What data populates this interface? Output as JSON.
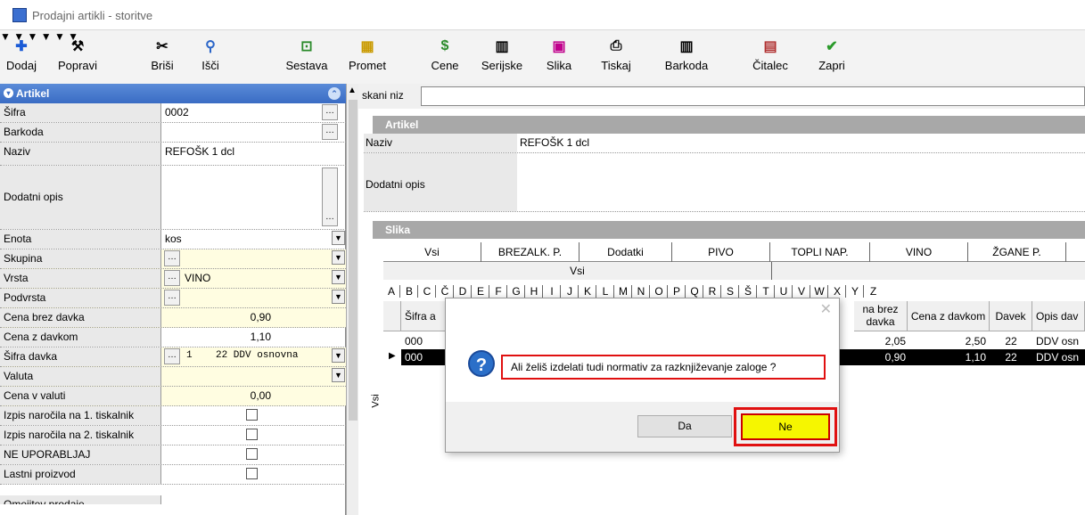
{
  "window": {
    "title": "Prodajni artikli - storitve"
  },
  "toolbar": {
    "items": [
      {
        "label": "Dodaj",
        "icon": "plus-icon"
      },
      {
        "label": "Popravi",
        "icon": "hammer-icon"
      },
      {
        "label": "Briši",
        "icon": "scissors-icon"
      },
      {
        "label": "Išči",
        "icon": "magnifier-icon"
      },
      {
        "label": "Sestava",
        "icon": "composition-icon"
      },
      {
        "label": "Promet",
        "icon": "turnover-icon"
      },
      {
        "label": "Cene",
        "icon": "price-icon"
      },
      {
        "label": "Serijske",
        "icon": "barcode-icon"
      },
      {
        "label": "Slika",
        "icon": "image-icon"
      },
      {
        "label": "Tiskaj",
        "icon": "printer-icon"
      },
      {
        "label": "Barkoda",
        "icon": "barcode-icon"
      },
      {
        "label": "Čitalec",
        "icon": "reader-icon"
      },
      {
        "label": "Zapri",
        "icon": "checkmark-icon"
      }
    ]
  },
  "left_panel": {
    "header": "Artikel",
    "fields": {
      "sifra": {
        "label": "Šifra",
        "value": "0002"
      },
      "barkoda": {
        "label": "Barkoda",
        "value": ""
      },
      "naziv": {
        "label": "Naziv",
        "value": "REFOŠK 1 dcl"
      },
      "dodatni_opis": {
        "label": "Dodatni opis",
        "value": ""
      },
      "enota": {
        "label": "Enota",
        "value": "kos"
      },
      "skupina": {
        "label": "Skupina",
        "value": ""
      },
      "vrsta": {
        "label": "Vrsta",
        "value": "VINO"
      },
      "podvrsta": {
        "label": "Podvrsta",
        "value": ""
      },
      "cena_brez_davka": {
        "label": "Cena brez davka",
        "value": "0,90"
      },
      "cena_z_davkom": {
        "label": "Cena z davkom",
        "value": "1,10"
      },
      "sifra_davka": {
        "label": "Šifra davka",
        "value": "1    22 DDV osnovna"
      },
      "valuta": {
        "label": "Valuta",
        "value": ""
      },
      "cena_v_valuti": {
        "label": "Cena v valuti",
        "value": "0,00"
      },
      "izpis1": {
        "label": "Izpis naročila na 1. tiskalnik",
        "checked": false
      },
      "izpis2": {
        "label": "Izpis naročila na 2. tiskalnik",
        "checked": false
      },
      "ne_uporabljaj": {
        "label": "NE UPORABLJAJ",
        "checked": false
      },
      "lastni": {
        "label": "Lastni proizvod",
        "checked": false
      }
    },
    "cut_row": "Omejitev prodaje"
  },
  "right_panel": {
    "search_label": "skani niz",
    "artikel_header": "Artikel",
    "naziv_label": "Naziv",
    "naziv_value": "REFOŠK 1 dcl",
    "dodatni_opis_label": "Dodatni opis",
    "slika_header": "Slika",
    "tabs": [
      "Vsi",
      "BREZALK. P.",
      "Dodatki",
      "PIVO",
      "TOPLI NAP.",
      "VINO",
      "ŽGANE P."
    ],
    "subtab": "Vsi",
    "side_label": "Vsi",
    "alphabet": [
      "A",
      "B",
      "C",
      "Č",
      "D",
      "E",
      "F",
      "G",
      "H",
      "I",
      "J",
      "K",
      "L",
      "M",
      "N",
      "O",
      "P",
      "Q",
      "R",
      "S",
      "Š",
      "T",
      "U",
      "V",
      "W",
      "X",
      "Y",
      "Z"
    ],
    "columns": [
      "Šifra a",
      "na brez davka",
      "Cena z davkom",
      "Davek",
      "Opis dav"
    ],
    "rows": [
      {
        "code": "000",
        "net": "2,05",
        "gross": "2,50",
        "tax": "22",
        "desc": "DDV osn"
      },
      {
        "code": "000",
        "net": "0,90",
        "gross": "1,10",
        "tax": "22",
        "desc": "DDV osn"
      }
    ]
  },
  "dialog": {
    "message": "Ali želiš izdelati tudi normativ za razknjiževanje zaloge ?",
    "yes_label": "Da",
    "no_label": "Ne"
  },
  "colors": {
    "header_blue": "#3a6cc4",
    "highlight_red": "#e01010",
    "button_yellow": "#f6f600",
    "field_yellow": "#fffde1"
  }
}
